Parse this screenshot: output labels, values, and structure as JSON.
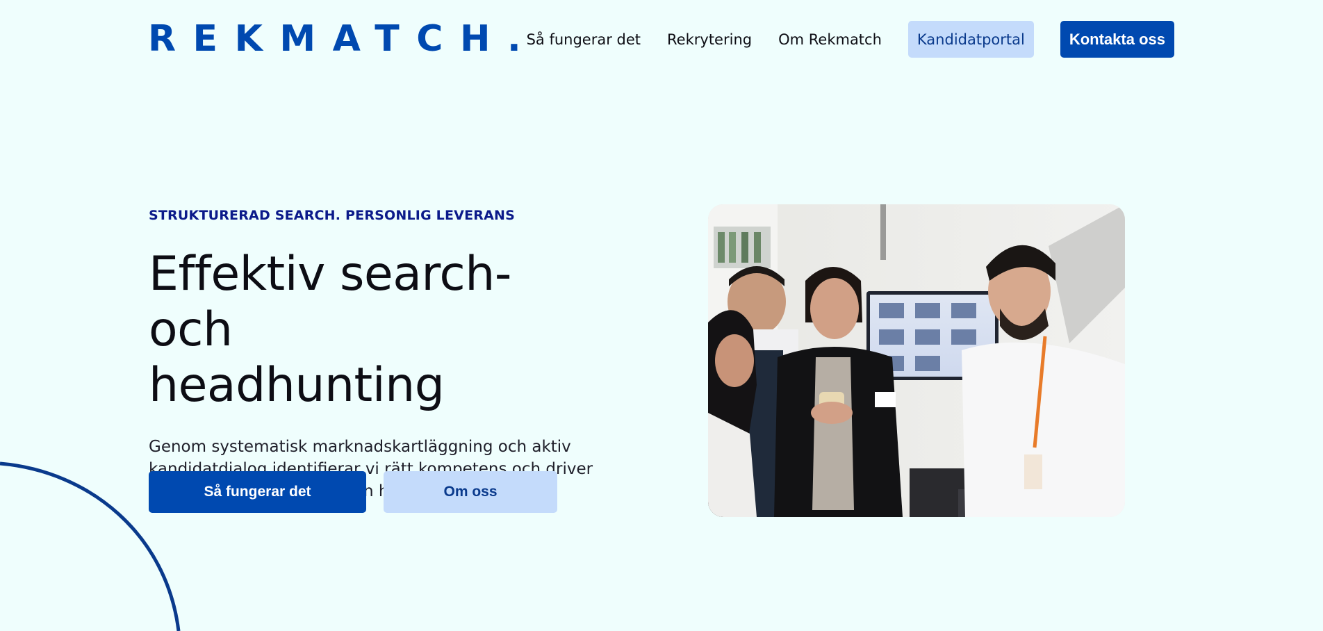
{
  "brand": {
    "logo_text": "REKMATCH",
    "logo_dot": ".",
    "accent_color": "#0049b0",
    "light_button_color": "#c4dbfb",
    "background_color": "#effefd"
  },
  "nav": {
    "items": [
      {
        "label": "Så fungerar det"
      },
      {
        "label": "Rekrytering"
      },
      {
        "label": "Om Rekmatch"
      }
    ],
    "portal_label": "Kandidatportal",
    "contact_label": "Kontakta oss"
  },
  "hero": {
    "eyebrow": "STRUKTURERAD SEARCH. PERSONLIG LEVERANS",
    "headline_line1": "Effektiv search- och",
    "headline_line2": "headhunting",
    "lead": "Genom systematisk marknadskartläggning och aktiv kandidatdialog identifierar vi rätt kompetens och driver processen hela vägen till en hållbar matchning.",
    "primary_cta": "Så fungerar det",
    "secondary_cta": "Om oss",
    "image_icon": "team-photo"
  }
}
